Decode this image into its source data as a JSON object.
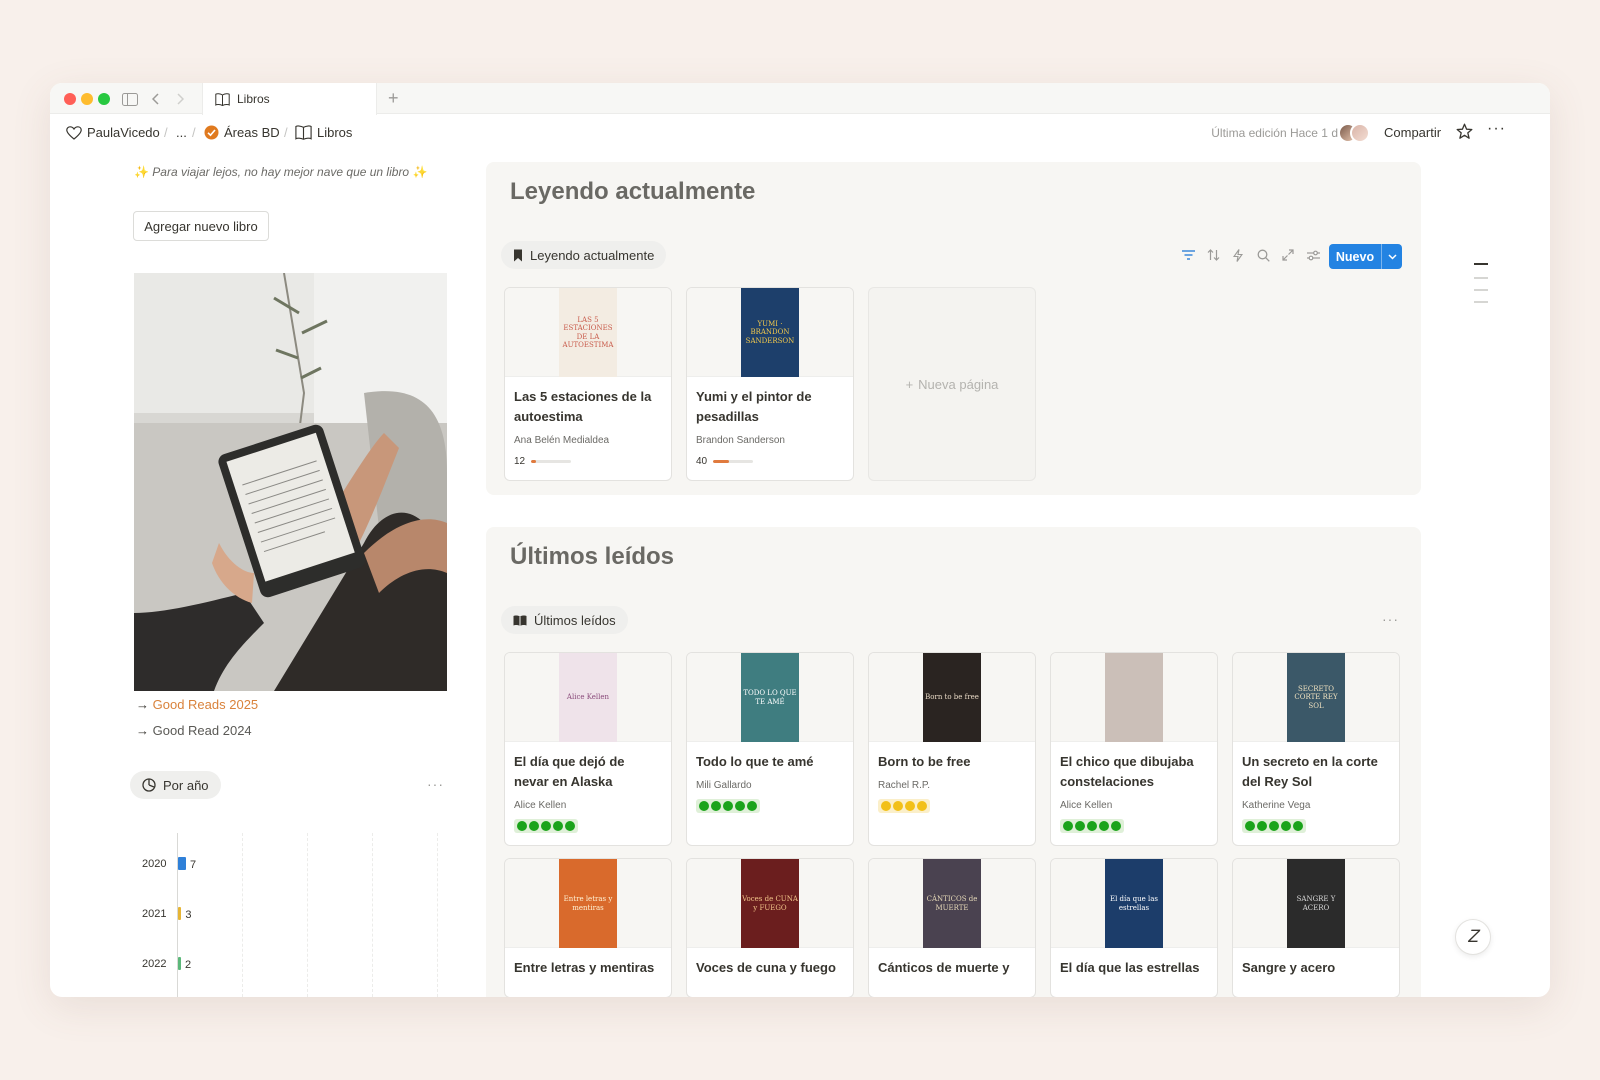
{
  "tab": {
    "title": "Libros",
    "icon": "open-book-icon"
  },
  "breadcrumb": {
    "workspace": "PaulaVicedo",
    "ellipsis": "...",
    "parent": "Áreas BD",
    "current": "Libros",
    "separator": "/"
  },
  "topbar": {
    "edited": "Última edición Hace 1 días",
    "share": "Compartir",
    "more": "···"
  },
  "left": {
    "quote_spark": "✨",
    "quote": "Para viajar lejos, no hay mejor nave que un libro",
    "add_button": "Agregar nuevo libro",
    "links": [
      {
        "arrow": "→",
        "label": "Good Reads 2025",
        "color": "#d9823b"
      },
      {
        "arrow": "→",
        "label": "Good Read 2024",
        "color": "#37352f"
      }
    ],
    "chart_pill": "Por año",
    "chart_more": "···"
  },
  "chart_data": {
    "type": "bar",
    "orientation": "horizontal",
    "categories": [
      "2020",
      "2021",
      "2022"
    ],
    "values": [
      7,
      3,
      2
    ],
    "colors": [
      "#2f80d8",
      "#e6b535",
      "#5cb87a"
    ],
    "title": "",
    "xlabel": "",
    "ylabel": "",
    "grid": true
  },
  "reading": {
    "title": "Leyendo actualmente",
    "view_label": "Leyendo actualmente",
    "new_button": "Nuevo",
    "new_page": "Nueva página",
    "toolbar_icons": [
      "filter-icon",
      "sort-icon",
      "lightning-icon",
      "search-icon",
      "expand-icon",
      "settings-icon"
    ],
    "books": [
      {
        "title": "Las 5 estaciones de la autoestima",
        "author": "Ana Belén Medialdea",
        "progress": 12,
        "cover_text": "LAS 5 ESTACIONES DE LA AUTOESTIMA",
        "cover_bg": "#f3ece2",
        "cover_fg": "#c85a4a"
      },
      {
        "title": "Yumi y el pintor de pesadillas",
        "author": "Brandon Sanderson",
        "progress": 40,
        "cover_text": "YUMI · BRANDON SANDERSON",
        "cover_bg": "#1d3f6b",
        "cover_fg": "#f2c94c"
      }
    ]
  },
  "recent": {
    "title": "Últimos leídos",
    "view_label": "Últimos leídos",
    "more": "···",
    "books": [
      {
        "title": "El día que dejó de nevar en Alaska",
        "author": "Alice Kellen",
        "rating": 5,
        "rating_color": "#1aa31a",
        "rating_bg": "#dff0d8",
        "cover_text": "Alice Kellen",
        "cover_bg": "#efe3ea",
        "cover_fg": "#8a4a7a"
      },
      {
        "title": "Todo lo que te amé",
        "author": "Mili Gallardo",
        "rating": 5,
        "rating_color": "#1aa31a",
        "rating_bg": "#dff0d8",
        "cover_text": "TODO LO QUE TE AMÉ",
        "cover_bg": "#3f7d80",
        "cover_fg": "#ffffff"
      },
      {
        "title": "Born to be free",
        "author": "Rachel R.P.",
        "rating": 4,
        "rating_color": "#f2c018",
        "rating_bg": "#fbefc9",
        "cover_text": "Born to be free",
        "cover_bg": "#2a2421",
        "cover_fg": "#e8d9c5"
      },
      {
        "title": "El chico que dibujaba constelaciones",
        "author": "Alice Kellen",
        "rating": 5,
        "rating_color": "#1aa31a",
        "rating_bg": "#dff0d8",
        "cover_text": "",
        "cover_bg": "#cbbfb8",
        "cover_fg": "#5a4a45"
      },
      {
        "title": "Un secreto en la corte del Rey Sol",
        "author": "Katherine Vega",
        "rating": 5,
        "rating_color": "#1aa31a",
        "rating_bg": "#dff0d8",
        "cover_text": "SECRETO CORTE REY SOL",
        "cover_bg": "#3b5868",
        "cover_fg": "#f0e2c0"
      },
      {
        "title": "Entre letras y mentiras",
        "author": "",
        "rating": 0,
        "cover_text": "Entre letras y mentiras",
        "cover_bg": "#d96a2c",
        "cover_fg": "#fff3d6"
      },
      {
        "title": "Voces de cuna y fuego",
        "author": "",
        "rating": 0,
        "cover_text": "Voces de CUNA y FUEGO",
        "cover_bg": "#6b1e1e",
        "cover_fg": "#f2c58a"
      },
      {
        "title": "Cánticos de muerte y",
        "author": "",
        "rating": 0,
        "cover_text": "CÁNTICOS de MUERTE",
        "cover_bg": "#4a4250",
        "cover_fg": "#e6d9b8"
      },
      {
        "title": "El día que las estrellas",
        "author": "",
        "rating": 0,
        "cover_text": "El día que las estrellas",
        "cover_bg": "#1c3d6a",
        "cover_fg": "#ffffff"
      },
      {
        "title": "Sangre y acero",
        "author": "",
        "rating": 0,
        "cover_text": "SANGRE Y ACERO",
        "cover_bg": "#2b2b2b",
        "cover_fg": "#d9d9d9"
      }
    ]
  },
  "help_icon": "Ꮓ"
}
